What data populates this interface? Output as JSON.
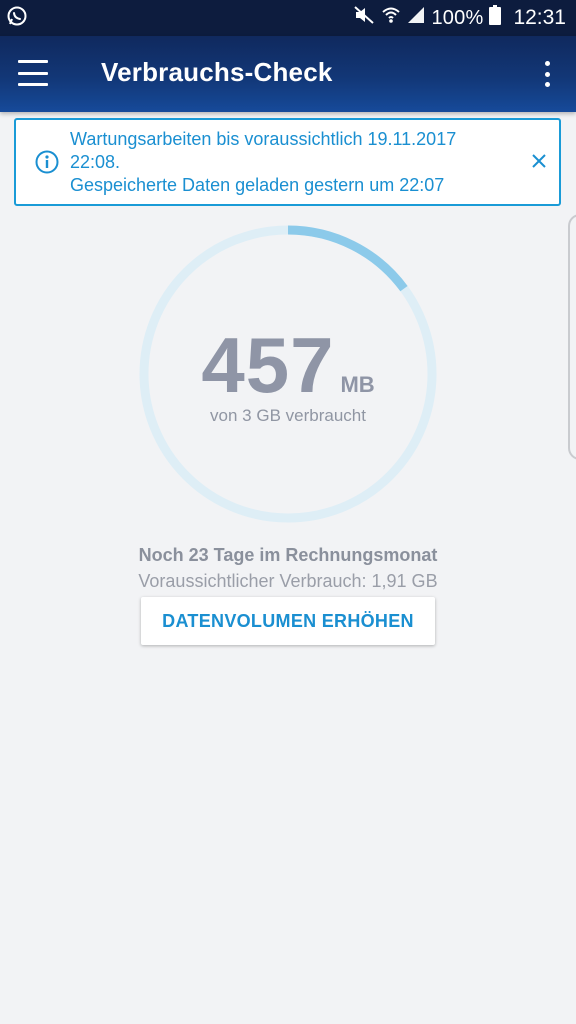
{
  "status_bar": {
    "battery_percent": "100%",
    "time": "12:31",
    "icons": [
      "whatsapp-icon",
      "mute-icon",
      "wifi-icon",
      "signal-icon",
      "battery-icon"
    ]
  },
  "toolbar": {
    "title": "Verbrauchs-Check",
    "menu_icon": "hamburger-menu-icon",
    "more_icon": "more-vert-icon"
  },
  "banner": {
    "line1": "Wartungsarbeiten bis voraussichtlich 19.11.2017",
    "line2": "22:08.",
    "line3": "Gespeicherte Daten geladen gestern um 22:07",
    "icon": "info-icon",
    "close_icon": "close-icon",
    "color": "#1a9bd7"
  },
  "usage": {
    "value": "457",
    "unit": "MB",
    "caption": "von 3 GB verbraucht",
    "used_fraction": 0.149,
    "track_color": "#deeef6",
    "progress_color": "#8ccaea"
  },
  "billing": {
    "days_left": "Noch 23 Tage im Rechnungsmonat",
    "forecast": "Voraussichtlicher Verbrauch: 1,91 GB"
  },
  "cta": {
    "label": "DATENVOLUMEN ERHÖHEN"
  }
}
